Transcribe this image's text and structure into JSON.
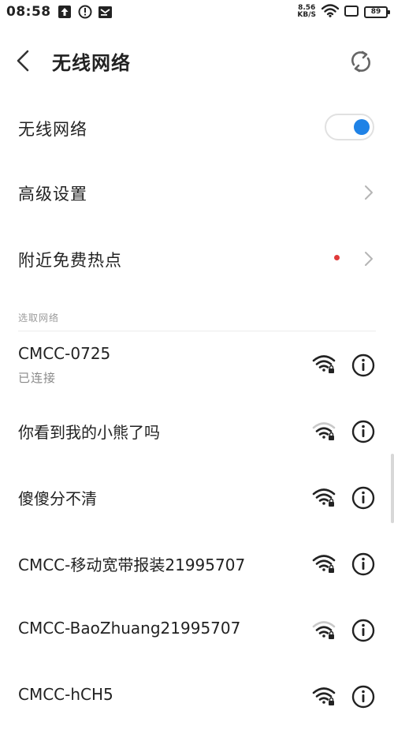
{
  "status_bar": {
    "time": "08:58",
    "net_speed_value": "8.56",
    "net_speed_unit": "KB/S",
    "battery": "89"
  },
  "header": {
    "title": "无线网络"
  },
  "settings": {
    "wifi_label": "无线网络",
    "wifi_enabled": true,
    "advanced_label": "高级设置",
    "hotspot_label": "附近免费热点"
  },
  "networks_section_title": "选取网络",
  "networks": [
    {
      "name": "CMCC-0725",
      "status": "已连接",
      "signal": "strong",
      "secured": true
    },
    {
      "name": "你看到我的小熊了吗",
      "signal": "weak",
      "secured": true
    },
    {
      "name": "傻傻分不清",
      "signal": "strong",
      "secured": true
    },
    {
      "name": "CMCC-移动宽带报装21995707",
      "signal": "strong",
      "secured": true
    },
    {
      "name": "CMCC-BaoZhuang21995707",
      "signal": "weak",
      "secured": true
    },
    {
      "name": "CMCC-hCH5",
      "signal": "strong",
      "secured": true
    }
  ],
  "colors": {
    "accent": "#1f82e6",
    "badge": "#e03a3a",
    "text": "#222222",
    "secondary_text": "#8a8a8a"
  }
}
